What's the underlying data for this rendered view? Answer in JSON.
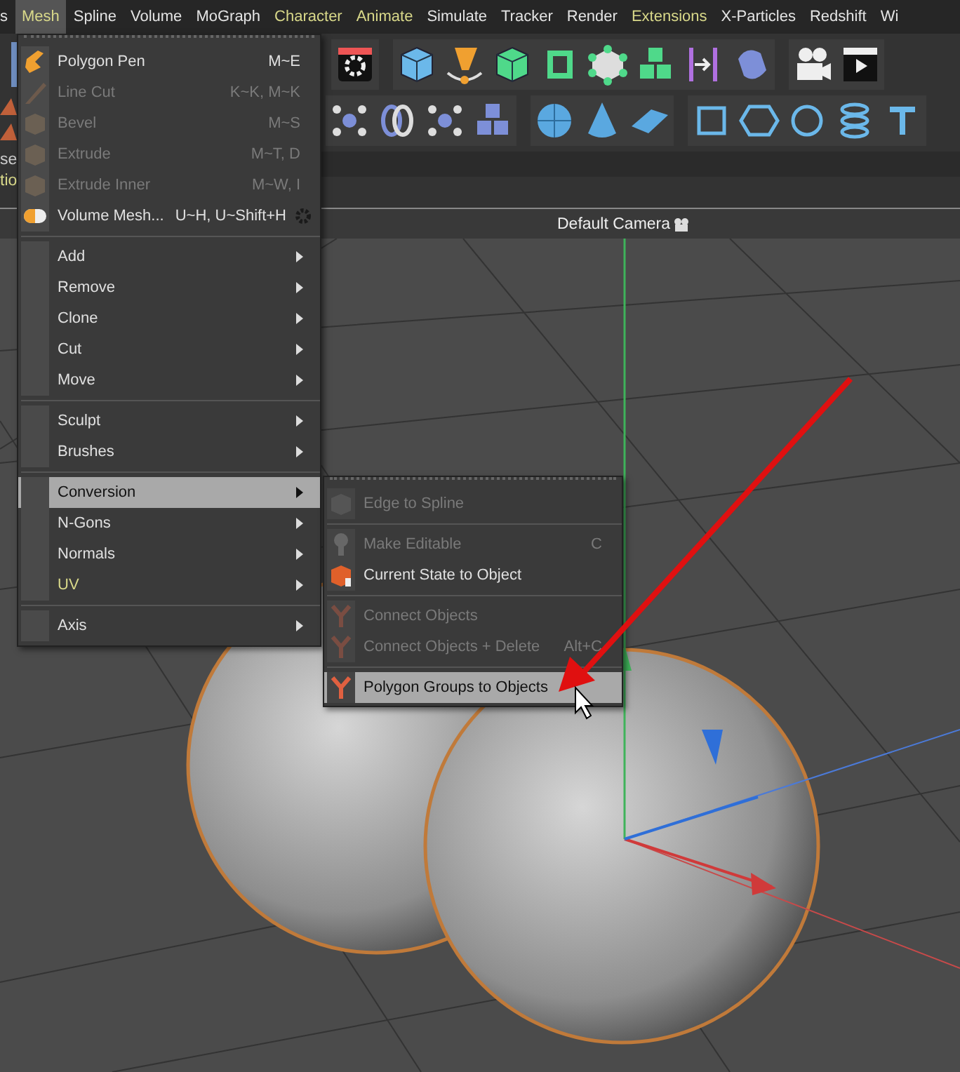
{
  "menubar": [
    {
      "label": "s",
      "selected": false,
      "accent": false
    },
    {
      "label": "Mesh",
      "selected": true,
      "accent": false
    },
    {
      "label": "Spline",
      "selected": false,
      "accent": false
    },
    {
      "label": "Volume",
      "selected": false,
      "accent": false
    },
    {
      "label": "MoGraph",
      "selected": false,
      "accent": false
    },
    {
      "label": "Character",
      "selected": false,
      "accent": true
    },
    {
      "label": "Animate",
      "selected": false,
      "accent": true
    },
    {
      "label": "Simulate",
      "selected": false,
      "accent": false
    },
    {
      "label": "Tracker",
      "selected": false,
      "accent": false
    },
    {
      "label": "Render",
      "selected": false,
      "accent": false
    },
    {
      "label": "Extensions",
      "selected": false,
      "accent": true
    },
    {
      "label": "X-Particles",
      "selected": false,
      "accent": false
    },
    {
      "label": "Redshift",
      "selected": false,
      "accent": false
    },
    {
      "label": "Wi",
      "selected": false,
      "accent": false
    }
  ],
  "left_panel": {
    "fragments": [
      {
        "text": "se",
        "accent": false
      },
      {
        "text": "tio",
        "accent": true
      }
    ]
  },
  "viewport": {
    "title": "Default Camera"
  },
  "mesh_menu": {
    "sections": [
      [
        {
          "label": "Polygon Pen",
          "shortcut": "M~E",
          "disabled": false,
          "selected": false,
          "accent": false,
          "submenu": false,
          "options": false
        },
        {
          "label": "Line Cut",
          "shortcut": "K~K, M~K",
          "disabled": true,
          "selected": false,
          "accent": false,
          "submenu": false,
          "options": false
        },
        {
          "label": "Bevel",
          "shortcut": "M~S",
          "disabled": true,
          "selected": false,
          "accent": false,
          "submenu": false,
          "options": false
        },
        {
          "label": "Extrude",
          "shortcut": "M~T, D",
          "disabled": true,
          "selected": false,
          "accent": false,
          "submenu": false,
          "options": false
        },
        {
          "label": "Extrude Inner",
          "shortcut": "M~W, I",
          "disabled": true,
          "selected": false,
          "accent": false,
          "submenu": false,
          "options": false
        },
        {
          "label": "Volume Mesh...",
          "shortcut": "U~H, U~Shift+H",
          "disabled": false,
          "selected": false,
          "accent": false,
          "submenu": false,
          "options": true
        }
      ],
      [
        {
          "label": "Add",
          "disabled": false,
          "selected": false,
          "accent": false,
          "submenu": true,
          "options": false
        },
        {
          "label": "Remove",
          "disabled": false,
          "selected": false,
          "accent": false,
          "submenu": true,
          "options": false
        },
        {
          "label": "Clone",
          "disabled": false,
          "selected": false,
          "accent": false,
          "submenu": true,
          "options": false
        },
        {
          "label": "Cut",
          "disabled": false,
          "selected": false,
          "accent": false,
          "submenu": true,
          "options": false
        },
        {
          "label": "Move",
          "disabled": false,
          "selected": false,
          "accent": false,
          "submenu": true,
          "options": false
        }
      ],
      [
        {
          "label": "Sculpt",
          "disabled": false,
          "selected": false,
          "accent": false,
          "submenu": true,
          "options": false
        },
        {
          "label": "Brushes",
          "disabled": false,
          "selected": false,
          "accent": false,
          "submenu": true,
          "options": false
        }
      ],
      [
        {
          "label": "Conversion",
          "disabled": false,
          "selected": true,
          "accent": false,
          "submenu": true,
          "options": false
        },
        {
          "label": "N-Gons",
          "disabled": false,
          "selected": false,
          "accent": false,
          "submenu": true,
          "options": false
        },
        {
          "label": "Normals",
          "disabled": false,
          "selected": false,
          "accent": false,
          "submenu": true,
          "options": false
        },
        {
          "label": "UV",
          "disabled": false,
          "selected": false,
          "accent": true,
          "submenu": true,
          "options": false
        }
      ],
      [
        {
          "label": "Axis",
          "disabled": false,
          "selected": false,
          "accent": false,
          "submenu": true,
          "options": false
        }
      ]
    ]
  },
  "conversion_submenu": {
    "sections": [
      [
        {
          "label": "Edge to Spline",
          "disabled": true,
          "selected": false
        }
      ],
      [
        {
          "label": "Make Editable",
          "shortcut": "C",
          "disabled": true,
          "selected": false
        },
        {
          "label": "Current State to Object",
          "disabled": false,
          "selected": false
        }
      ],
      [
        {
          "label": "Connect Objects",
          "disabled": true,
          "selected": false
        },
        {
          "label": "Connect Objects + Delete",
          "shortcut": "Alt+C",
          "disabled": true,
          "selected": false
        }
      ],
      [
        {
          "label": "Polygon Groups to Objects",
          "disabled": false,
          "selected": true
        }
      ]
    ]
  }
}
